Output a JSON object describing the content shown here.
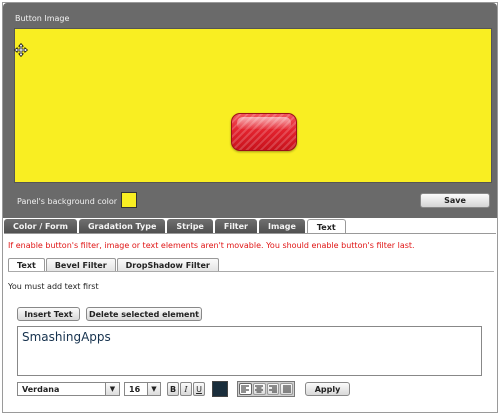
{
  "panel": {
    "title": "Button Image",
    "canvas_color": "#f9ee22",
    "button_color": "#e3232e",
    "bg_label": "Panel's background color",
    "bg_color": "#f9ee22",
    "save_label": "Save",
    "move_icon": "move-arrows-icon"
  },
  "main_tabs": [
    {
      "label": "Color / Form",
      "active": false
    },
    {
      "label": "Gradation Type",
      "active": false
    },
    {
      "label": "Stripe",
      "active": false
    },
    {
      "label": "Filter",
      "active": false
    },
    {
      "label": "Image",
      "active": false
    },
    {
      "label": "Text",
      "active": true
    }
  ],
  "warning": "If enable button's filter, image or text elements aren't movable. You should enable button's filter last.",
  "sub_tabs": [
    {
      "label": "Text",
      "active": true
    },
    {
      "label": "Bevel Filter",
      "active": false
    },
    {
      "label": "DropShadow Filter",
      "active": false
    }
  ],
  "text_panel": {
    "hint": "You must add text first",
    "insert_label": "Insert Text",
    "delete_label": "Delete selected element",
    "text_value": "SmashingApps"
  },
  "toolbar": {
    "font": "Verdana",
    "size": "16",
    "bold": "B",
    "italic": "I",
    "underline": "U",
    "text_color": "#1a2e3c",
    "apply_label": "Apply",
    "alignments": [
      {
        "name": "align-left-icon",
        "active": true
      },
      {
        "name": "align-center-icon",
        "active": false
      },
      {
        "name": "align-right-icon",
        "active": false
      },
      {
        "name": "align-justify-icon",
        "active": false
      }
    ]
  }
}
